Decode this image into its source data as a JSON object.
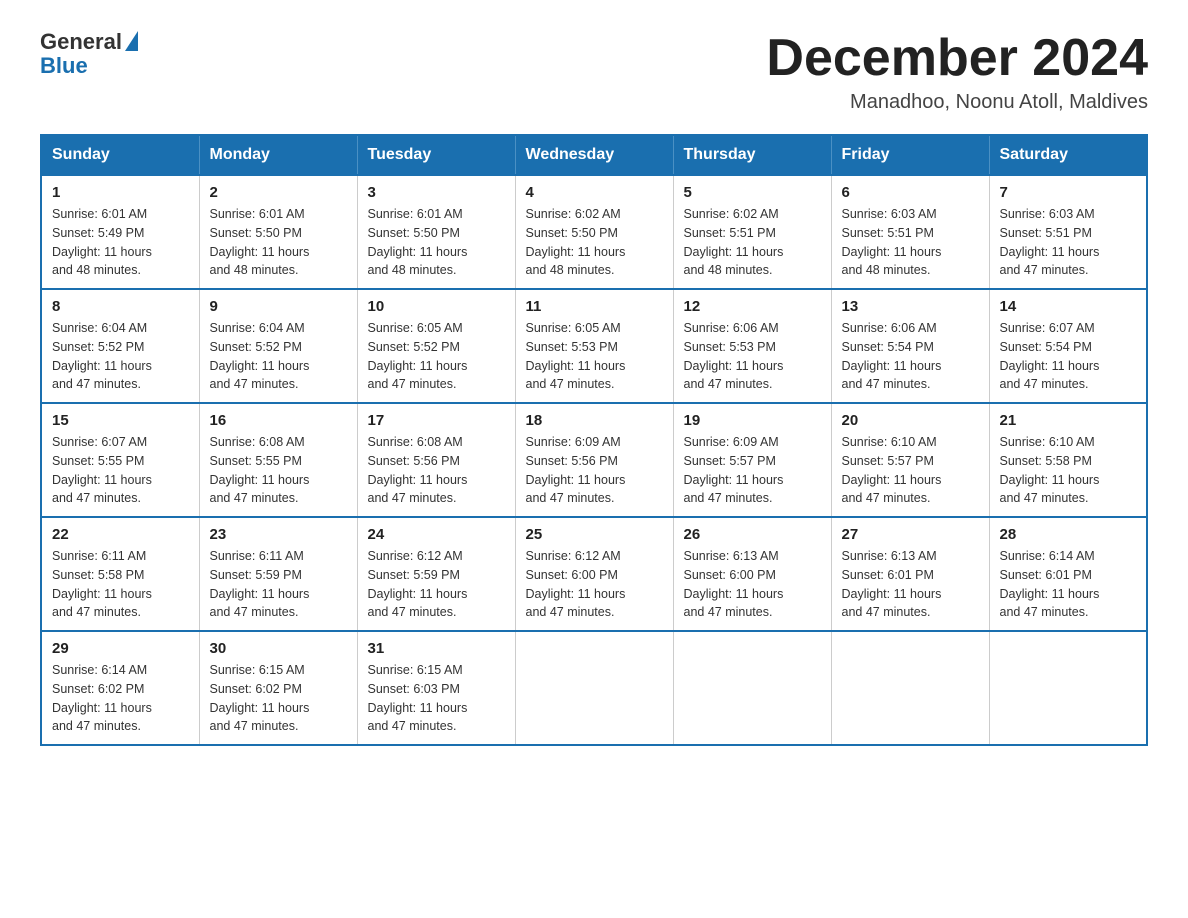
{
  "logo": {
    "text_general": "General",
    "text_blue": "Blue",
    "aria": "GeneralBlue logo"
  },
  "header": {
    "month_year": "December 2024",
    "location": "Manadhoo, Noonu Atoll, Maldives"
  },
  "days_of_week": [
    "Sunday",
    "Monday",
    "Tuesday",
    "Wednesday",
    "Thursday",
    "Friday",
    "Saturday"
  ],
  "weeks": [
    [
      {
        "day": "1",
        "sunrise": "6:01 AM",
        "sunset": "5:49 PM",
        "daylight": "11 hours and 48 minutes."
      },
      {
        "day": "2",
        "sunrise": "6:01 AM",
        "sunset": "5:50 PM",
        "daylight": "11 hours and 48 minutes."
      },
      {
        "day": "3",
        "sunrise": "6:01 AM",
        "sunset": "5:50 PM",
        "daylight": "11 hours and 48 minutes."
      },
      {
        "day": "4",
        "sunrise": "6:02 AM",
        "sunset": "5:50 PM",
        "daylight": "11 hours and 48 minutes."
      },
      {
        "day": "5",
        "sunrise": "6:02 AM",
        "sunset": "5:51 PM",
        "daylight": "11 hours and 48 minutes."
      },
      {
        "day": "6",
        "sunrise": "6:03 AM",
        "sunset": "5:51 PM",
        "daylight": "11 hours and 48 minutes."
      },
      {
        "day": "7",
        "sunrise": "6:03 AM",
        "sunset": "5:51 PM",
        "daylight": "11 hours and 47 minutes."
      }
    ],
    [
      {
        "day": "8",
        "sunrise": "6:04 AM",
        "sunset": "5:52 PM",
        "daylight": "11 hours and 47 minutes."
      },
      {
        "day": "9",
        "sunrise": "6:04 AM",
        "sunset": "5:52 PM",
        "daylight": "11 hours and 47 minutes."
      },
      {
        "day": "10",
        "sunrise": "6:05 AM",
        "sunset": "5:52 PM",
        "daylight": "11 hours and 47 minutes."
      },
      {
        "day": "11",
        "sunrise": "6:05 AM",
        "sunset": "5:53 PM",
        "daylight": "11 hours and 47 minutes."
      },
      {
        "day": "12",
        "sunrise": "6:06 AM",
        "sunset": "5:53 PM",
        "daylight": "11 hours and 47 minutes."
      },
      {
        "day": "13",
        "sunrise": "6:06 AM",
        "sunset": "5:54 PM",
        "daylight": "11 hours and 47 minutes."
      },
      {
        "day": "14",
        "sunrise": "6:07 AM",
        "sunset": "5:54 PM",
        "daylight": "11 hours and 47 minutes."
      }
    ],
    [
      {
        "day": "15",
        "sunrise": "6:07 AM",
        "sunset": "5:55 PM",
        "daylight": "11 hours and 47 minutes."
      },
      {
        "day": "16",
        "sunrise": "6:08 AM",
        "sunset": "5:55 PM",
        "daylight": "11 hours and 47 minutes."
      },
      {
        "day": "17",
        "sunrise": "6:08 AM",
        "sunset": "5:56 PM",
        "daylight": "11 hours and 47 minutes."
      },
      {
        "day": "18",
        "sunrise": "6:09 AM",
        "sunset": "5:56 PM",
        "daylight": "11 hours and 47 minutes."
      },
      {
        "day": "19",
        "sunrise": "6:09 AM",
        "sunset": "5:57 PM",
        "daylight": "11 hours and 47 minutes."
      },
      {
        "day": "20",
        "sunrise": "6:10 AM",
        "sunset": "5:57 PM",
        "daylight": "11 hours and 47 minutes."
      },
      {
        "day": "21",
        "sunrise": "6:10 AM",
        "sunset": "5:58 PM",
        "daylight": "11 hours and 47 minutes."
      }
    ],
    [
      {
        "day": "22",
        "sunrise": "6:11 AM",
        "sunset": "5:58 PM",
        "daylight": "11 hours and 47 minutes."
      },
      {
        "day": "23",
        "sunrise": "6:11 AM",
        "sunset": "5:59 PM",
        "daylight": "11 hours and 47 minutes."
      },
      {
        "day": "24",
        "sunrise": "6:12 AM",
        "sunset": "5:59 PM",
        "daylight": "11 hours and 47 minutes."
      },
      {
        "day": "25",
        "sunrise": "6:12 AM",
        "sunset": "6:00 PM",
        "daylight": "11 hours and 47 minutes."
      },
      {
        "day": "26",
        "sunrise": "6:13 AM",
        "sunset": "6:00 PM",
        "daylight": "11 hours and 47 minutes."
      },
      {
        "day": "27",
        "sunrise": "6:13 AM",
        "sunset": "6:01 PM",
        "daylight": "11 hours and 47 minutes."
      },
      {
        "day": "28",
        "sunrise": "6:14 AM",
        "sunset": "6:01 PM",
        "daylight": "11 hours and 47 minutes."
      }
    ],
    [
      {
        "day": "29",
        "sunrise": "6:14 AM",
        "sunset": "6:02 PM",
        "daylight": "11 hours and 47 minutes."
      },
      {
        "day": "30",
        "sunrise": "6:15 AM",
        "sunset": "6:02 PM",
        "daylight": "11 hours and 47 minutes."
      },
      {
        "day": "31",
        "sunrise": "6:15 AM",
        "sunset": "6:03 PM",
        "daylight": "11 hours and 47 minutes."
      },
      null,
      null,
      null,
      null
    ]
  ],
  "labels": {
    "sunrise": "Sunrise:",
    "sunset": "Sunset:",
    "daylight": "Daylight:"
  }
}
